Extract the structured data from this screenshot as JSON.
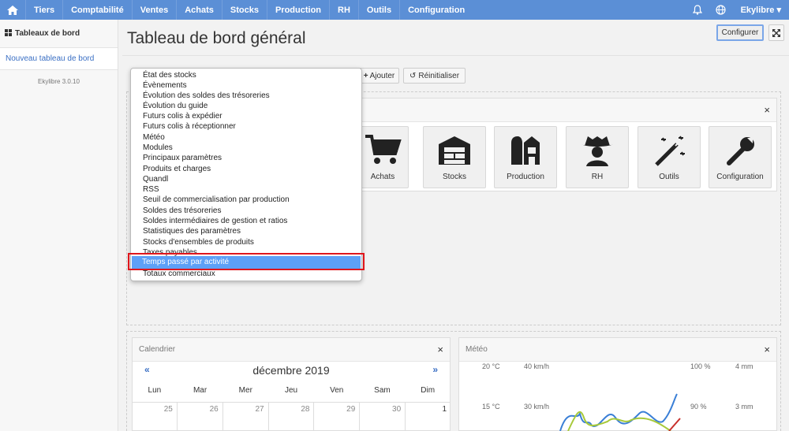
{
  "nav": {
    "items": [
      "Tiers",
      "Comptabilité",
      "Ventes",
      "Achats",
      "Stocks",
      "Production",
      "RH",
      "Outils",
      "Configuration"
    ],
    "user": "Ekylibre"
  },
  "sidebar": {
    "header": "Tableaux de bord",
    "item": "Nouveau tableau de bord",
    "version": "Ekylibre 3.0.10"
  },
  "page": {
    "title": "Tableau de bord général",
    "configure_label": "Configurer",
    "add_label": "Ajouter",
    "reset_label": "Réinitialiser"
  },
  "dropdown": {
    "items": [
      "État des stocks",
      "Évènements",
      "Évolution des soldes des trésoreries",
      "Évolution du guide",
      "Futurs colis à expédier",
      "Futurs colis à réceptionner",
      "Météo",
      "Modules",
      "Principaux paramètres",
      "Produits et charges",
      "Quandl",
      "RSS",
      "Seuil de commercialisation par production",
      "Soldes des trésoreries",
      "Soldes intermédiaires de gestion et ratios",
      "Statistiques des paramètres",
      "Stocks d'ensembles de produits",
      "Taxes payables",
      "Temps passé par activité",
      "Totaux commerciaux"
    ],
    "selected": "Temps passé par activité"
  },
  "modules": {
    "close": "×",
    "tiles": [
      "Achats",
      "Stocks",
      "Production",
      "RH",
      "Outils",
      "Configuration"
    ]
  },
  "calendar": {
    "title": "Calendrier",
    "close": "×",
    "prev": "«",
    "next": "»",
    "month": "décembre 2019",
    "weekdays": [
      "Lun",
      "Mar",
      "Mer",
      "Jeu",
      "Ven",
      "Sam",
      "Dim"
    ],
    "days": [
      "25",
      "26",
      "27",
      "28",
      "29",
      "30",
      "1"
    ]
  },
  "meteo": {
    "title": "Météo",
    "close": "×",
    "temp_ticks": [
      "20 °C",
      "15 °C"
    ],
    "wind_ticks": [
      "40 km/h",
      "30 km/h"
    ],
    "hum_ticks": [
      "100 %",
      "90 %"
    ],
    "rain_ticks": [
      "4 mm",
      "3 mm"
    ]
  }
}
